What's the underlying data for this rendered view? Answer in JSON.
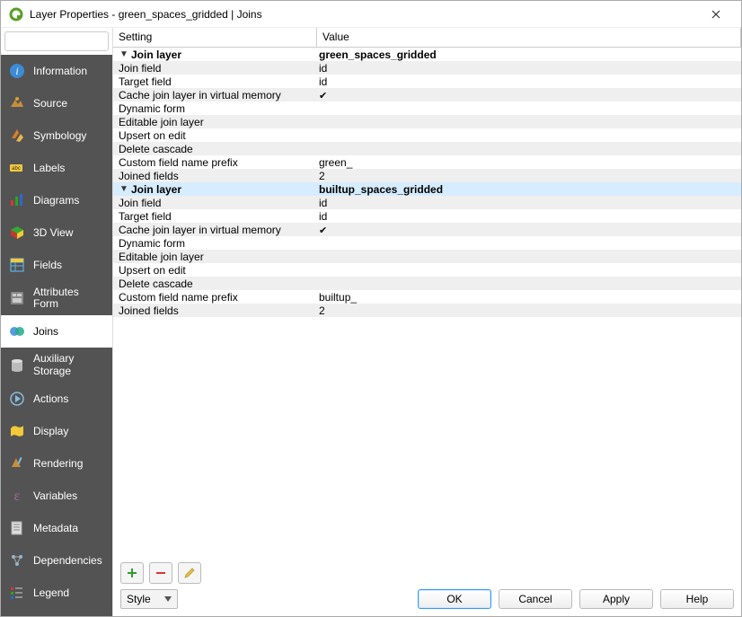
{
  "window": {
    "title": "Layer Properties - green_spaces_gridded | Joins"
  },
  "sidebar": {
    "search_placeholder": "",
    "items": [
      {
        "id": "information",
        "label": "Information"
      },
      {
        "id": "source",
        "label": "Source"
      },
      {
        "id": "symbology",
        "label": "Symbology"
      },
      {
        "id": "labels",
        "label": "Labels"
      },
      {
        "id": "diagrams",
        "label": "Diagrams"
      },
      {
        "id": "3dview",
        "label": "3D View"
      },
      {
        "id": "fields",
        "label": "Fields"
      },
      {
        "id": "attributes-form",
        "label": "Attributes Form"
      },
      {
        "id": "joins",
        "label": "Joins"
      },
      {
        "id": "auxiliary-storage",
        "label": "Auxiliary Storage"
      },
      {
        "id": "actions",
        "label": "Actions"
      },
      {
        "id": "display",
        "label": "Display"
      },
      {
        "id": "rendering",
        "label": "Rendering"
      },
      {
        "id": "variables",
        "label": "Variables"
      },
      {
        "id": "metadata",
        "label": "Metadata"
      },
      {
        "id": "dependencies",
        "label": "Dependencies"
      },
      {
        "id": "legend",
        "label": "Legend"
      }
    ]
  },
  "columns": {
    "setting": "Setting",
    "value": "Value"
  },
  "joins": [
    {
      "group_label": "Join layer",
      "group_value": "green_spaces_gridded",
      "expanded": true,
      "selected": false,
      "children": [
        {
          "label": "Join field",
          "value": "id"
        },
        {
          "label": "Target field",
          "value": "id"
        },
        {
          "label": "Cache join layer in virtual memory",
          "value": "✔"
        },
        {
          "label": "Dynamic form",
          "value": ""
        },
        {
          "label": "Editable join layer",
          "value": ""
        },
        {
          "label": "Upsert on edit",
          "value": ""
        },
        {
          "label": "Delete cascade",
          "value": ""
        },
        {
          "label": "Custom field name prefix",
          "value": "green_"
        },
        {
          "label": "Joined fields",
          "value": "2"
        }
      ]
    },
    {
      "group_label": "Join layer",
      "group_value": "builtup_spaces_gridded",
      "expanded": true,
      "selected": true,
      "children": [
        {
          "label": "Join field",
          "value": "id"
        },
        {
          "label": "Target field",
          "value": "id"
        },
        {
          "label": "Cache join layer in virtual memory",
          "value": "✔"
        },
        {
          "label": "Dynamic form",
          "value": ""
        },
        {
          "label": "Editable join layer",
          "value": ""
        },
        {
          "label": "Upsert on edit",
          "value": ""
        },
        {
          "label": "Delete cascade",
          "value": ""
        },
        {
          "label": "Custom field name prefix",
          "value": "builtup_"
        },
        {
          "label": "Joined fields",
          "value": "2"
        }
      ]
    }
  ],
  "footer": {
    "style": "Style",
    "ok": "OK",
    "cancel": "Cancel",
    "apply": "Apply",
    "help": "Help"
  }
}
